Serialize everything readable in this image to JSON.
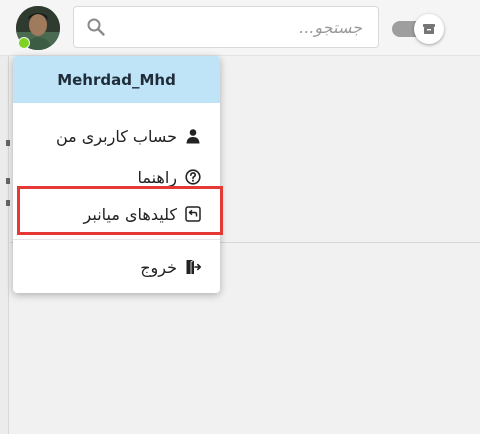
{
  "header": {
    "search": {
      "placeholder": "جستجو...",
      "value": ""
    },
    "avatar": {
      "online": true,
      "status_color": "#7ed321"
    },
    "toggle": {
      "state": "off"
    }
  },
  "user_menu": {
    "username": "Mehrdad_Mhd",
    "header_color": "#bfe3f7",
    "items": [
      {
        "label": "حساب کاربری من",
        "icon": "user-icon"
      },
      {
        "label": "راهنما",
        "icon": "help-circle-icon"
      },
      {
        "label": "کلیدهای میانبر",
        "icon": "keyboard-shortcut-icon",
        "highlighted": true
      },
      {
        "label": "خروج",
        "icon": "logout-icon"
      }
    ],
    "highlight_color": "#e53935"
  }
}
